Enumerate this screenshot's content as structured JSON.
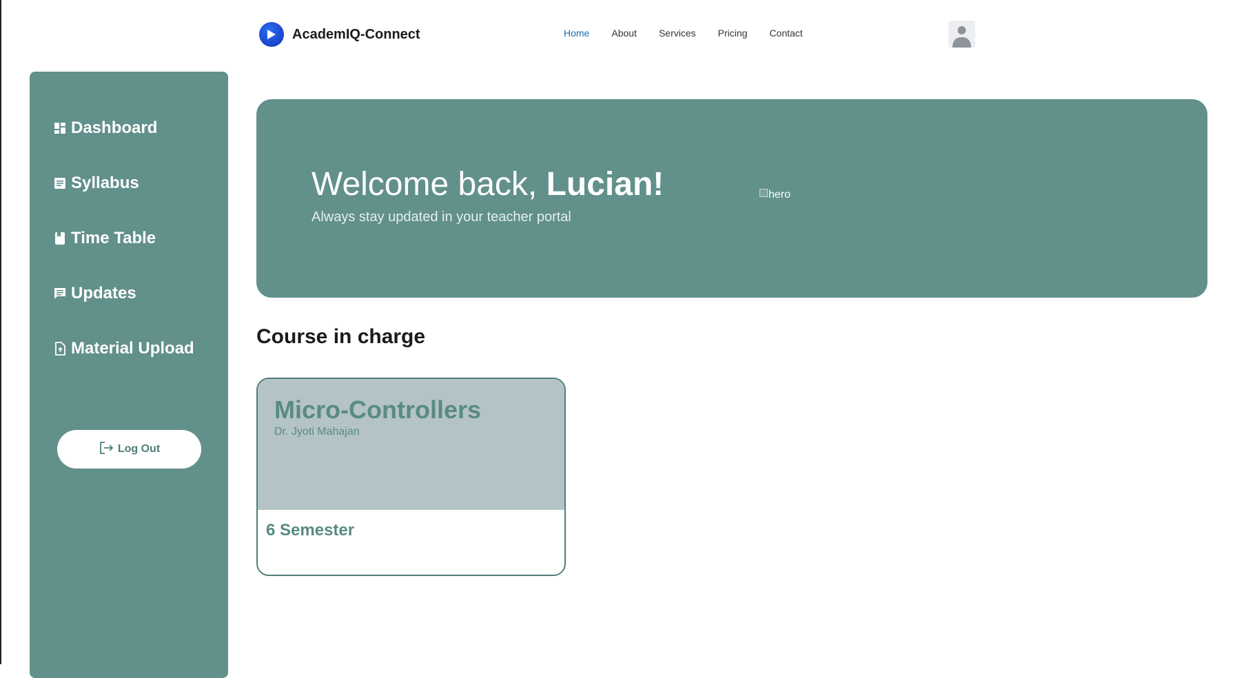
{
  "header": {
    "brand": "AcademIQ-Connect",
    "nav": [
      {
        "label": "Home",
        "active": true
      },
      {
        "label": "About",
        "active": false
      },
      {
        "label": "Services",
        "active": false
      },
      {
        "label": "Pricing",
        "active": false
      },
      {
        "label": "Contact",
        "active": false
      }
    ],
    "avatar_icon": "user-avatar-icon"
  },
  "sidebar": {
    "items": [
      {
        "label": "Dashboard",
        "icon": "dashboard-icon"
      },
      {
        "label": "Syllabus",
        "icon": "document-icon"
      },
      {
        "label": "Time Table",
        "icon": "book-icon"
      },
      {
        "label": "Updates",
        "icon": "message-icon"
      },
      {
        "label": "Material Upload",
        "icon": "file-upload-icon"
      }
    ],
    "logout_label": "Log Out"
  },
  "hero": {
    "greeting": "Welcome back, ",
    "name": "Lucian!",
    "subtitle": "Always stay updated in your teacher portal",
    "image_alt": "hero"
  },
  "section": {
    "title": "Course in charge"
  },
  "courses": [
    {
      "name": "Micro-Controllers",
      "teacher": "Dr. Jyoti Mahajan",
      "semester": "6 Semester"
    }
  ],
  "colors": {
    "primary": "#62908b",
    "card_top": "#b3c3c6",
    "accent_text": "#5a8a85",
    "nav_active": "#1a6fb0"
  }
}
